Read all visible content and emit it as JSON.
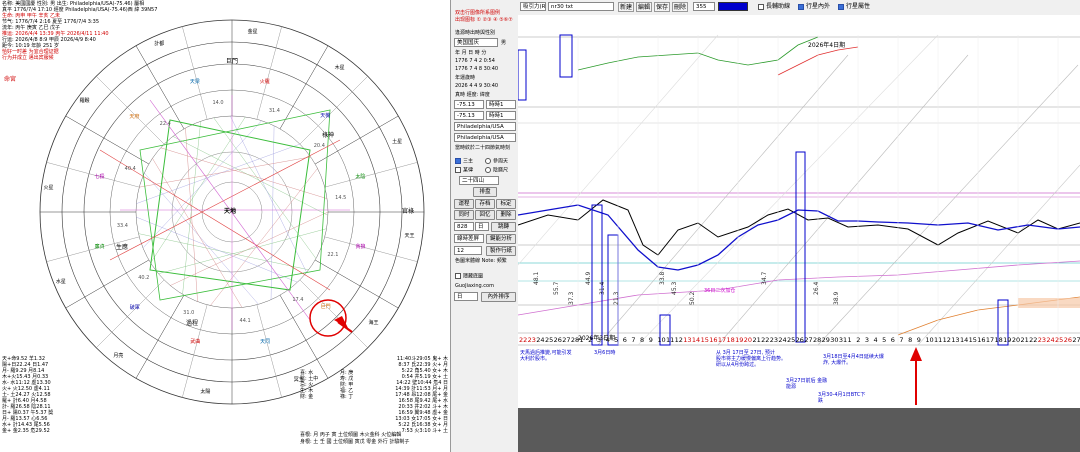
{
  "left_header": {
    "line1": "名称: 美國國慶  性別: 男  出生: Philadelphia/USA(-75.46) 屬相",
    "line2": "真平 1776/7/4 17:10 經度 Philadelphia/USA(-75.46)西 緯 39N57",
    "line3": "生命: 丙申 甲午 辛亥 乙未",
    "line4": "节气: 1776/7/4 2:16  夏至 1776/7/4 3:35",
    "line5": "流年: 丙午 庚寅 乙巳 戊子",
    "line6": "推运: 2026/4/4 13:39 丙午 2026/4/11 11:40",
    "line7": "行运: 2026/4/8 8:9 甲辰 2026/4/9 8:40",
    "line8": "距今: 10:19 年齡 251 岁",
    "line9": "恰好一时差  为宜合理证据",
    "line10": "行为并成立  邁出宾服候"
  },
  "chart_wheel": {
    "center_label": "天地",
    "top_label": "巨門",
    "label_shengying": "生應",
    "label_guocheng": "過程",
    "label_lushen": "祿神",
    "left_side": "命宮",
    "right_side": "官祿",
    "outer_labels": [
      "金星",
      "木星",
      "土星",
      "天王",
      "海王",
      "冥王",
      "太陽",
      "月亮",
      "水星",
      "火星",
      "羅睺",
      "計都"
    ],
    "stars_ring": [
      "火羅",
      "天機",
      "太陰",
      "貪狼",
      "巨門",
      "天同",
      "武曲",
      "破軍",
      "廉貞",
      "七殺",
      "天府",
      "天梁"
    ],
    "ring_numbers": [
      "31.4",
      "20.4",
      "14.5",
      "22.1",
      "17.4",
      "44.1",
      "31.0",
      "40.2",
      "33.4",
      "40.4",
      "22.4",
      "14.0"
    ]
  },
  "left_bottom": {
    "col1": [
      "天+命9.52 羊1.32",
      "陽+日22.24 日1.47",
      "月- 羅9.29 月8.14",
      "木+火15.43 月0.33",
      "水- 水11:12 虛13.30",
      "火+ 火12.50 虛4.11",
      "土- 土24.27 火12.58",
      "羅+ 計6.40 月4.58",
      "計- 羅26.58 陰28.11",
      "日+ 陽0.37 午5.37 獎",
      "月- 羅13.57 心6.56",
      "水+ 計14.43 尾5.56",
      "金+ 金2.35 危29.52"
    ],
    "col2": [
      "11:40斗29:05 鬼+ 木",
      "8:37 氐22:39 火+ 月",
      "5:22 角5.40 女+ 木",
      "0:54 井5.19 女+ 土",
      "14:22 壁10:44 危4 日",
      "14:39 計11:53 月+ 月",
      "17:48 昂12:08 尾+ 金",
      "16:58 尾9.42 尾+ 水",
      "20:33 井2:02 斗+ 木",
      "16:59 翼9:48 虛+ 金",
      "13:03 女17:05 女+ 日",
      "5:22 氐16:38 女+ 月",
      "7:53 火3:10 斗+ 土"
    ],
    "mid_block1": [
      "喜: 水",
      "陰: 土中",
      "忌: 火",
      "生: 木",
      "財: 金"
    ],
    "mid_block2": [
      "月: 庚",
      "寿: 戊",
      "財: 甲",
      "福: 乙",
      "祿: 丁"
    ],
    "footer1": "喜根: 月 丙子 寅 土位傾圖 木火金科 火位編輯",
    "footer2": "身根: 土 壬 國 土位傾圖 寅戊 零金 外行 計驗制子"
  },
  "mid_panel": {
    "red_text": [
      "双击行图像所系图例",
      "出现图标 ①  ②③ ④  ⑤⑥⑦"
    ],
    "input_value": "美国国庆",
    "input_label": "男",
    "subheader": "逢源時出時與性別",
    "table_header": "年  月  日  時  分",
    "row1": [
      "1776",
      "7",
      "4",
      "2",
      "0:54"
    ],
    "row2": [
      "1776",
      "7",
      "4",
      "8",
      "30:40"
    ],
    "label_yun": "年運歲時",
    "label_addr": "真時 經度: 緯度",
    "row3": [
      "2026",
      "4",
      "4",
      "9",
      "30:40"
    ],
    "sel1": "-75.13",
    "sel1b": "時時1",
    "sel2": "-75.13",
    "sel2b": "時時1",
    "city1": "Philadelphia/USA",
    "city2": "Philadelphia/USA",
    "hint": "當時紋於二十四節氣時刻",
    "chk_sanzhu": "三主",
    "chk_xiaomei": "參周天",
    "chk_moujin": "某律",
    "chk_yinchi": "陰曆尺",
    "sel_mode": "二十四山",
    "btn_pai": "排盘",
    "btn_row1": [
      "運程",
      "存档",
      "标定"
    ],
    "btn_row2": [
      "同时",
      "回忆",
      "删除"
    ],
    "sel_num": "828",
    "sel_num2": "日",
    "btn_jump": "跳轉",
    "sel_lines": "線時差屏",
    "btn_analyze": "鍵能分析",
    "num_value": "12",
    "btn_make": "製作行紙",
    "lab_note": "色圖米體線 Note: 频繁",
    "chk_hide": "隱藏底圖",
    "site": "GuoJiaxing.com",
    "sel_day": "日",
    "btn_sort": "內外排序"
  },
  "toolbar": {
    "sel_star": "吸引力(R)",
    "sel_file": "nr30 txt",
    "btn_new": "新建",
    "btn_edit": "編輯",
    "btn_save": "保存",
    "btn_delete": "刪除",
    "value": "355",
    "color_hex": "#0000cc",
    "chk_long": "長輔助線",
    "chk_transit": "行星內外",
    "chk_transit_on": true,
    "chk_long_on": false,
    "btn_grid": "行星屬性"
  },
  "timeline": {
    "month_label1": "2026年3日期",
    "month_label2": "2026年4日期",
    "dates_top": [
      "22",
      "23",
      "24",
      "25",
      "26",
      "27",
      "28",
      "1",
      "2",
      "3",
      "4",
      "5",
      "6",
      "7",
      "8",
      "9",
      "10",
      "11",
      "12",
      "13",
      "14",
      "15",
      "16",
      "17",
      "18",
      "19",
      "20",
      "21",
      "22",
      "23",
      "24",
      "25",
      "26",
      "27",
      "28",
      "29",
      "30",
      "31",
      "1",
      "2",
      "3",
      "4",
      "5",
      "6",
      "7",
      "8",
      "9",
      "10",
      "11",
      "12",
      "13",
      "14",
      "15",
      "16",
      "17",
      "18",
      "19",
      "20",
      "21",
      "22",
      "23",
      "24",
      "25",
      "26",
      "27"
    ],
    "red_positions": [
      0,
      1,
      19,
      20,
      21,
      22,
      23,
      24,
      25,
      26,
      60,
      61,
      62,
      63
    ],
    "ann1": "天馬過后推變,可能引发\n大利於股市。",
    "ann2": "3月6日時",
    "ann3": "从 3月 17日至 27日, 预计\n股市将主力缓慢偏离上行趋势。\n研以从4月份跨过。",
    "ann4": "3月18日至4月4日延续大爆\n炸, 大爆仟。",
    "ann5": "3月27日前后 金融\n能源",
    "ann6": "3月30-4月1日BTC下\n跌",
    "mid_ann": "36日二次加仓",
    "vert_labels": [
      "48.1",
      "55.7",
      "37.3",
      "44.9",
      "31.4",
      "21.3",
      "33.8",
      "45.3",
      "50.2",
      "34.7",
      "26.4",
      "38.9"
    ]
  },
  "colors": {
    "accent_blue": "#0000cc",
    "red_arrow": "#e00000",
    "box_blue": "#0000cc",
    "gray_bar": "#5a5a5a"
  }
}
